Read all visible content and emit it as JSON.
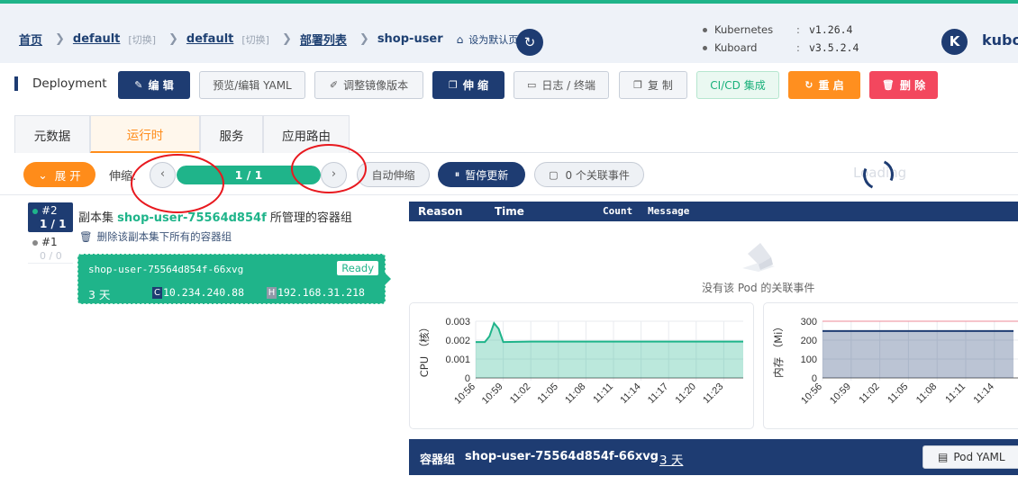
{
  "breadcrumb": {
    "home": "首页",
    "ns1": "default",
    "switch1": "[切换]",
    "ns2": "default",
    "switch2": "[切换]",
    "list": "部署列表",
    "current": "shop-user",
    "set_default": "设为默认页"
  },
  "versions": {
    "k8s_label": "Kubernetes",
    "k8s_colon": ":",
    "k8s_value": "v1.26.4",
    "kb_label": "Kuboard",
    "kb_colon": ":",
    "kb_value": "v3.5.2.4"
  },
  "user": {
    "avatar": "K",
    "name": "kuboa"
  },
  "toolbar": {
    "title": "Deployment",
    "edit": "编 辑",
    "yaml": "预览/编辑 YAML",
    "image": "调整镜像版本",
    "scale": "伸 缩",
    "logs": "日志 / 终端",
    "copy": "复 制",
    "cicd": "CI/CD 集成",
    "restart": "重 启",
    "delete": "删 除"
  },
  "tabs": [
    {
      "label": "元数据"
    },
    {
      "label": "运行时"
    },
    {
      "label": "服务"
    },
    {
      "label": "应用路由"
    }
  ],
  "controls": {
    "expand": "展 开",
    "scale_label": "伸缩:",
    "prev": "‹",
    "progress": "1 / 1",
    "progress_fraction": 1.0,
    "next": "›",
    "auto_scale": "自动伸缩",
    "pause": "暂停更新",
    "events": "0 个关联事件",
    "loading": "Loading"
  },
  "replicasets": {
    "current_rev": "#2",
    "current_count": "1 / 1",
    "old_rev": "#1",
    "old_count": "0 / 0",
    "title_prefix": "副本集",
    "title_name": "shop-user-75564d854f",
    "title_suffix": "所管理的容器组",
    "delete_all": "删除该副本集下所有的容器组"
  },
  "pod": {
    "name": "shop-user-75564d854f-66xvg",
    "status": "Ready",
    "age": "3 天",
    "cluster_ip_key": "C",
    "cluster_ip": "10.234.240.88",
    "host_ip_key": "H",
    "host_ip": "192.168.31.218"
  },
  "events": {
    "columns": [
      "Reason",
      "Time",
      "Count",
      "Message"
    ],
    "empty_text": "没有该 Pod 的关联事件"
  },
  "chart_data": [
    {
      "type": "area",
      "ylabel": "CPU （核）",
      "ylim": [
        0,
        0.003
      ],
      "yticks": [
        "0.003",
        "0.002",
        "0.001",
        "0"
      ],
      "x": [
        "10:56",
        "10:59",
        "11:02",
        "11:05",
        "11:08",
        "11:11",
        "11:14",
        "11:17",
        "11:20",
        "11:23"
      ],
      "series": [
        {
          "color": "#1fb48a",
          "points": [
            [
              "10:56",
              0.0019
            ],
            [
              "10:57",
              0.0019
            ],
            [
              "10:57.5",
              0.0022
            ],
            [
              "10:58",
              0.0029
            ],
            [
              "10:58.5",
              0.0026
            ],
            [
              "10:59",
              0.0019
            ],
            [
              "11:02",
              0.00192
            ],
            [
              "11:26",
              0.00192
            ]
          ]
        }
      ]
    },
    {
      "type": "area",
      "ylabel": "内存 （Mi）",
      "ylim": [
        0,
        300
      ],
      "yticks": [
        "300",
        "200",
        "100",
        "0"
      ],
      "x": [
        "10:56",
        "10:59",
        "11:02",
        "11:05",
        "11:08",
        "11:11",
        "11:14"
      ],
      "series": [
        {
          "color": "#1e3c72",
          "points": [
            [
              "10:56",
              248
            ],
            [
              "11:16",
              248
            ]
          ]
        }
      ],
      "limit_color": "#f3475e"
    }
  ],
  "container": {
    "label": "容器组",
    "name": "shop-user-75564d854f-66xvg",
    "age": "3 天",
    "pod_yaml": "Pod YAML"
  }
}
